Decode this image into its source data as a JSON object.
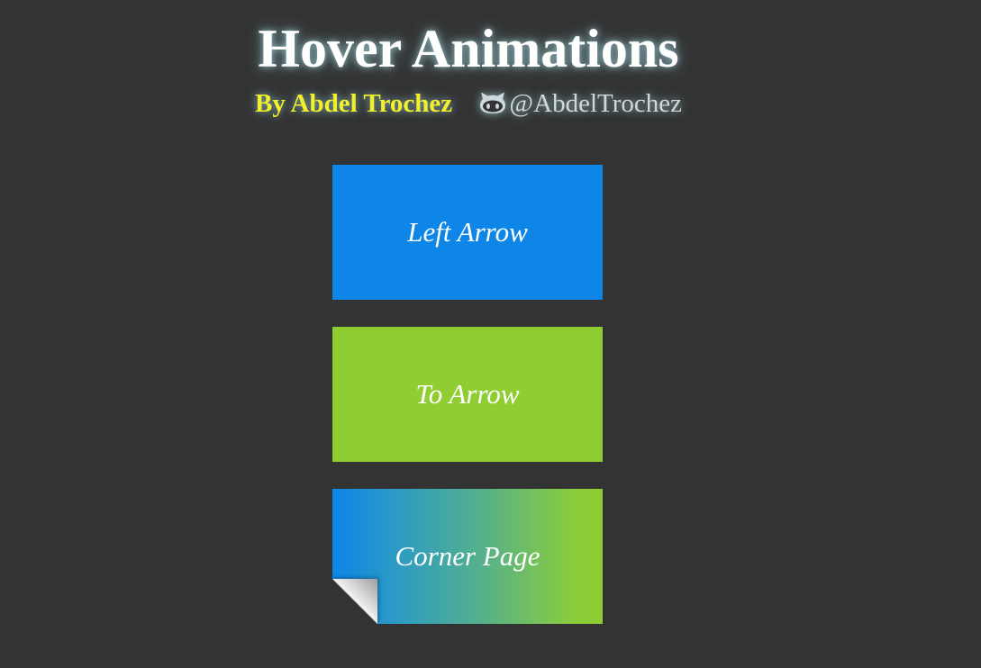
{
  "header": {
    "title": "Hover Animations",
    "author": "By Abdel Trochez",
    "social_icon": "github-octocat-icon",
    "handle": "@AbdelTrochez"
  },
  "tiles": [
    {
      "label": "Left Arrow",
      "color": "#0d86e8"
    },
    {
      "label": "To Arrow",
      "color": "#8fcd33"
    },
    {
      "label": "Corner Page",
      "gradient": [
        "#0d86e8",
        "#8fcd33"
      ]
    }
  ],
  "colors": {
    "background": "#333333",
    "title": "#ffffff",
    "author": "#f2ef2b",
    "handle": "#d6d6d6",
    "glow": "#aae6f0"
  }
}
